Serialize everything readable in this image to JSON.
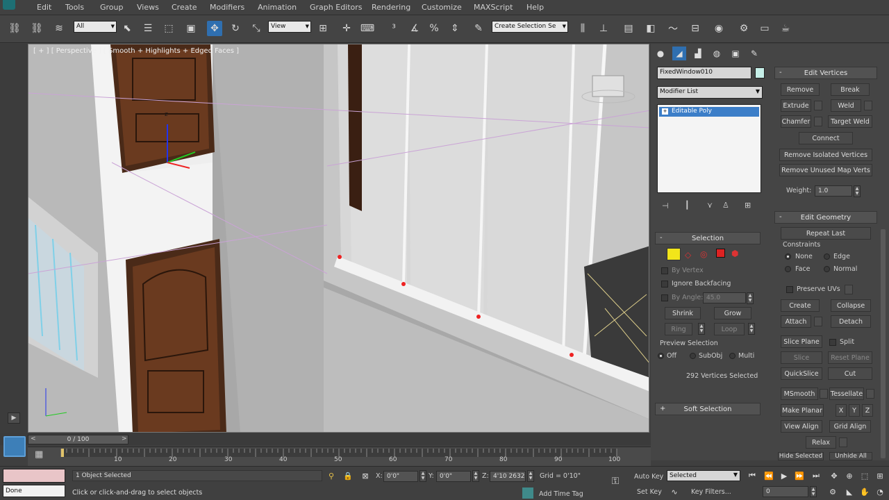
{
  "menu": [
    "Edit",
    "Tools",
    "Group",
    "Views",
    "Create",
    "Modifiers",
    "Animation",
    "Graph Editors",
    "Rendering",
    "Customize",
    "MAXScript",
    "Help"
  ],
  "toolbar": {
    "selection_filter": "All",
    "ref_coord": "View",
    "named_selection": "Create Selection Se"
  },
  "viewport": {
    "label": "[ + ] [ Perspective ] [ Smooth + Highlights + Edged Faces ]",
    "gizmo_axis_label": "z"
  },
  "panel": {
    "tabs": [
      "create-icon",
      "modify-icon",
      "hierarchy-icon",
      "motion-icon",
      "display-icon",
      "utilities-icon"
    ],
    "object_name": "FixedWindow010",
    "modifier_list": "Modifier List",
    "stack_item": "Editable Poly",
    "selection": {
      "title": "Selection",
      "by_vertex": "By Vertex",
      "ignore_backfacing": "Ignore Backfacing",
      "by_angle": "By Angle:",
      "by_angle_value": "45.0",
      "shrink": "Shrink",
      "grow": "Grow",
      "ring": "Ring",
      "loop": "Loop",
      "preview_title": "Preview Selection",
      "preview_off": "Off",
      "preview_subobj": "SubObj",
      "preview_multi": "Multi",
      "status": "292 Vertices Selected"
    },
    "soft_selection": "Soft Selection",
    "edit_vertices": {
      "title": "Edit Vertices",
      "remove": "Remove",
      "break": "Break",
      "extrude": "Extrude",
      "weld": "Weld",
      "chamfer": "Chamfer",
      "target_weld": "Target Weld",
      "connect": "Connect",
      "remove_isolated": "Remove Isolated Vertices",
      "remove_unused": "Remove Unused Map Verts",
      "weight_label": "Weight:",
      "weight_value": "1.0"
    },
    "edit_geometry": {
      "title": "Edit Geometry",
      "repeat_last": "Repeat Last",
      "constraints": "Constraints",
      "none": "None",
      "edge": "Edge",
      "face": "Face",
      "normal": "Normal",
      "preserve_uvs": "Preserve UVs",
      "create": "Create",
      "collapse": "Collapse",
      "attach": "Attach",
      "detach": "Detach",
      "slice_plane": "Slice Plane",
      "split": "Split",
      "slice": "Slice",
      "reset_plane": "Reset Plane",
      "quickslice": "QuickSlice",
      "cut": "Cut",
      "msmooth": "MSmooth",
      "tessellate": "Tessellate",
      "make_planar": "Make Planar",
      "x": "X",
      "y": "Y",
      "z": "Z",
      "view_align": "View Align",
      "grid_align": "Grid Align",
      "relax": "Relax",
      "hide_selected": "Hide Selected",
      "unhide_all": "Unhide All"
    }
  },
  "timeline": {
    "slider": "0 / 100",
    "ticks": [
      "10",
      "20",
      "30",
      "40",
      "50",
      "60",
      "70",
      "80",
      "90",
      "100"
    ]
  },
  "status": {
    "objects_selected": "1 Object Selected",
    "prompt": "Click or click-and-drag to select objects",
    "x_label": "X:",
    "x_value": "0'0\"",
    "y_label": "Y:",
    "y_value": "0'0\"",
    "z_label": "Z:",
    "z_value": "4'10 2632\"",
    "grid": "Grid = 0'10\"",
    "add_time_tag": "Add Time Tag",
    "auto_key": "Auto Key",
    "key_mode": "Selected",
    "set_key": "Set Key",
    "key_filters": "Key Filters...",
    "frame_value": "0",
    "done": "Done"
  }
}
